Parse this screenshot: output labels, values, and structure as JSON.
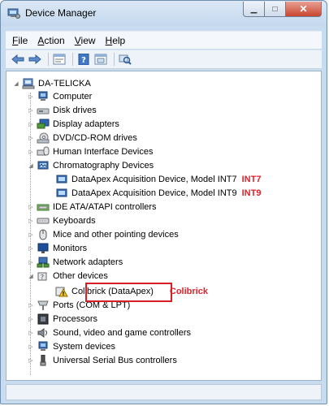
{
  "window": {
    "title": "Device Manager"
  },
  "window_buttons": {
    "minimize": "▁",
    "maximize": "□",
    "close": "✕"
  },
  "menu": [
    {
      "label": "File",
      "mnemonic": "F",
      "rest": "ile"
    },
    {
      "label": "Action",
      "mnemonic": "A",
      "rest": "ction"
    },
    {
      "label": "View",
      "mnemonic": "V",
      "rest": "iew"
    },
    {
      "label": "Help",
      "mnemonic": "H",
      "rest": "elp"
    }
  ],
  "toolbar": [
    "back-icon",
    "forward-icon",
    "properties-icon",
    "help-icon",
    "show-hidden-icon",
    "scan-hardware-icon"
  ],
  "tree": {
    "root": "DA-TELICKA",
    "nodes": [
      {
        "label": "Computer",
        "icon": "computer-icon",
        "expanded": false
      },
      {
        "label": "Disk drives",
        "icon": "disk-drive-icon",
        "expanded": false
      },
      {
        "label": "Display adapters",
        "icon": "display-adapter-icon",
        "expanded": false
      },
      {
        "label": "DVD/CD-ROM drives",
        "icon": "dvd-drive-icon",
        "expanded": false
      },
      {
        "label": "Human Interface Devices",
        "icon": "hid-icon",
        "expanded": false
      },
      {
        "label": "Chromatography Devices",
        "icon": "chromatography-icon",
        "expanded": true,
        "children": [
          {
            "label": "DataApex Acquisition Device, Model INT7",
            "tag": "INT7"
          },
          {
            "label": "DataApex Acquisition Device, Model INT9",
            "tag": "INT9"
          }
        ]
      },
      {
        "label": "IDE ATA/ATAPI controllers",
        "icon": "ide-controller-icon",
        "expanded": false
      },
      {
        "label": "Keyboards",
        "icon": "keyboard-icon",
        "expanded": false
      },
      {
        "label": "Mice and other pointing devices",
        "icon": "mouse-icon",
        "expanded": false
      },
      {
        "label": "Monitors",
        "icon": "monitor-icon",
        "expanded": false
      },
      {
        "label": "Network adapters",
        "icon": "network-adapter-icon",
        "expanded": false
      },
      {
        "label": "Other devices",
        "icon": "other-devices-icon",
        "expanded": true,
        "children": [
          {
            "label": "Colibrick (DataApex)",
            "tag": "Colibrick",
            "warning": true
          }
        ]
      },
      {
        "label": "Ports (COM & LPT)",
        "icon": "port-icon",
        "expanded": false
      },
      {
        "label": "Processors",
        "icon": "processor-icon",
        "expanded": false
      },
      {
        "label": "Sound, video and game controllers",
        "icon": "sound-icon",
        "expanded": false
      },
      {
        "label": "System devices",
        "icon": "system-devices-icon",
        "expanded": false
      },
      {
        "label": "Universal Serial Bus controllers",
        "icon": "usb-icon",
        "expanded": false
      }
    ]
  },
  "colors": {
    "annotation_red": "#e0202a",
    "highlight_border": "#d81d27"
  }
}
